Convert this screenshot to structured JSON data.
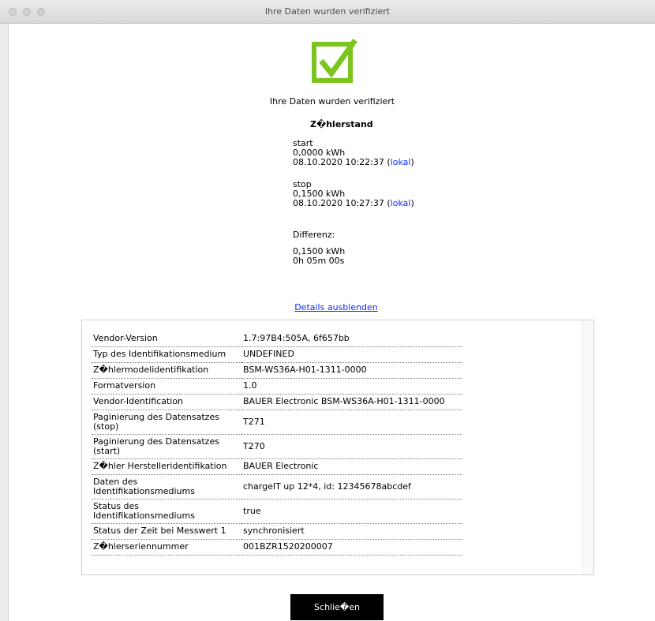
{
  "window": {
    "title": "Ihre Daten wurden verifiziert"
  },
  "colors": {
    "check_green": "#7cc51f",
    "link_blue": "#0a2cff"
  },
  "header": {
    "icon": "checkbox-checked-icon",
    "headline": "Ihre Daten wurden verifiziert"
  },
  "meter": {
    "title": "Z�hlerstand",
    "start": {
      "label": "start",
      "value": "0,0000 kWh",
      "timestamp": "08.10.2020 10:22:37 (",
      "local_link": "lokal",
      "close_paren": ")"
    },
    "stop": {
      "label": "stop",
      "value": "0,1500 kWh",
      "timestamp": "08.10.2020 10:27:37 (",
      "local_link": "lokal",
      "close_paren": ")"
    },
    "difference": {
      "label": "Differenz:",
      "value": "0,1500 kWh",
      "duration": "0h 05m 00s"
    }
  },
  "details_link": "Details ausblenden",
  "details": [
    {
      "key": "Vendor-Version",
      "value": "1.7:97B4:505A, 6f657bb"
    },
    {
      "key": "Typ des Identifikationsmedium",
      "value": "UNDEFINED"
    },
    {
      "key": "Z�hlermodelidentifikation",
      "value": "BSM-WS36A-H01-1311-0000"
    },
    {
      "key": "Formatversion",
      "value": "1.0"
    },
    {
      "key": "Vendor-Identification",
      "value": "BAUER Electronic BSM-WS36A-H01-1311-0000"
    },
    {
      "key": "Paginierung des Datensatzes (stop)",
      "value": "T271"
    },
    {
      "key": "Paginierung des Datensatzes (start)",
      "value": "T270"
    },
    {
      "key": "Z�hler Herstelleridentifikation",
      "value": "BAUER Electronic"
    },
    {
      "key": "Daten des Identifikationsmediums",
      "value": "chargeIT up 12*4, id: 12345678abcdef"
    },
    {
      "key": "Status des Identifikationsmediums",
      "value": "true"
    },
    {
      "key": "Status der Zeit bei Messwert 1",
      "value": "synchronisiert"
    },
    {
      "key": "Z�hlerseriennummer",
      "value": "001BZR1520200007"
    }
  ],
  "close_button": "Schlie�en"
}
